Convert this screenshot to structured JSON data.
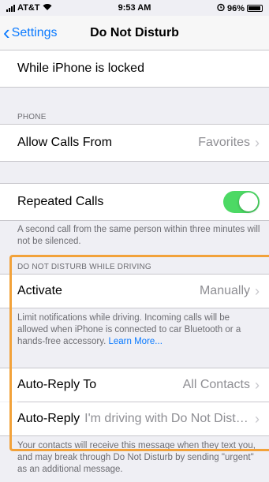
{
  "status_bar": {
    "carrier": "AT&T",
    "time": "9:53 AM",
    "battery_percent": "96%"
  },
  "nav": {
    "back_label": "Settings",
    "title": "Do Not Disturb"
  },
  "locked_row": {
    "label": "While iPhone is locked"
  },
  "phone_section": {
    "header": "PHONE",
    "allow_calls": {
      "label": "Allow Calls From",
      "value": "Favorites"
    }
  },
  "repeated_calls": {
    "label": "Repeated Calls",
    "enabled": true,
    "footer": "A second call from the same person within three minutes will not be silenced."
  },
  "driving_section": {
    "header": "DO NOT DISTURB WHILE DRIVING",
    "activate": {
      "label": "Activate",
      "value": "Manually"
    },
    "activate_footer": "Limit notifications while driving. Incoming calls will be allowed when iPhone is connected to car Bluetooth or a hands-free accessory.",
    "learn_more": "Learn More...",
    "auto_reply_to": {
      "label": "Auto-Reply To",
      "value": "All Contacts"
    },
    "auto_reply": {
      "label": "Auto-Reply",
      "value": "I'm driving with Do Not Distu..."
    },
    "auto_reply_footer": "Your contacts will receive this message when they text you, and may break through Do Not Disturb by sending \"urgent\" as an additional message."
  },
  "colors": {
    "accent": "#0a7aff",
    "toggle_on": "#4cd964",
    "highlight": "#f2a23a"
  },
  "icons": {
    "signal": "cellular-signal-icon",
    "wifi": "wifi-icon",
    "alarm": "alarm-icon",
    "battery": "battery-icon",
    "back": "chevron-left-icon",
    "disclosure": "chevron-right-icon"
  }
}
